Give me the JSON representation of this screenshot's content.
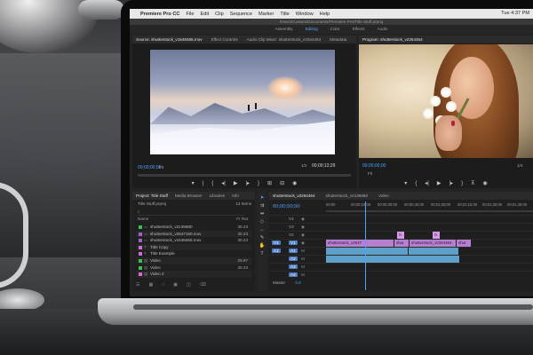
{
  "menubar": {
    "app": "Premiere Pro CC",
    "items": [
      "File",
      "Edit",
      "Clip",
      "Sequence",
      "Marker",
      "Title",
      "Window",
      "Help"
    ],
    "clock": "Tue 4:37 PM"
  },
  "path": "/Users/Custom/Documents/Premiere Pro/Title Stuff.prproj",
  "workspaces": [
    "Assembly",
    "Editing",
    "Color",
    "Effects",
    "Audio"
  ],
  "source": {
    "tabs": [
      "Source: shutterstock_v1548465.mov",
      "Effect Controls",
      "Audio Clip Mixer: shutterstock_v2264464",
      "Metadata"
    ],
    "timecode": "00;00;00;00",
    "fit": "Fit",
    "fraction": "1/2",
    "duration": "00;00;13;29"
  },
  "program": {
    "tab": "Program: shutterstock_v2264464",
    "timecode": "00;00;00;00",
    "fit": "Fit",
    "fraction": "1/4"
  },
  "transport_icons": [
    "mark-in",
    "mark-out",
    "go-to-in",
    "step-back",
    "play",
    "step-forward",
    "go-to-out",
    "insert",
    "overwrite",
    "export-frame"
  ],
  "project": {
    "tabs": [
      "Project: Title Stuff",
      "Media Browser",
      "Libraries",
      "Info"
    ],
    "file": "Title Stuff.prproj",
    "items_count": "13 Items",
    "col_name": "Name",
    "col_frame": "Fr Rat",
    "rows": [
      {
        "name": "shutterstock_v2136680",
        "dur": "30.23",
        "color": "#38c05a"
      },
      {
        "name": "shutterstock_v2647160.mov",
        "dur": "30.23",
        "color": "#9f64c8"
      },
      {
        "name": "shutterstock_v1548465.mov",
        "dur": "30.23",
        "color": "#9f64c8"
      },
      {
        "name": "Title Copy",
        "dur": "",
        "color": "#d56cd6"
      },
      {
        "name": "Title Example",
        "dur": "",
        "color": "#d56cd6"
      },
      {
        "name": "Video",
        "dur": "29.97",
        "color": "#38c05a"
      },
      {
        "name": "Video",
        "dur": "30.23",
        "color": "#38c05a"
      },
      {
        "name": "Video 2",
        "dur": "",
        "color": "#d56cd6"
      }
    ]
  },
  "timeline": {
    "tabs": [
      "shutterstock_v2264464",
      "shutterstock_v2136680",
      "Video"
    ],
    "timecode": "00;00;00;00",
    "ruler": [
      "00;00",
      "00;00;15;00",
      "00;00;30;00",
      "00;00;45;00",
      "00;01;00;00",
      "00;01;15;00",
      "00;01;30;00",
      "00;01;45;00"
    ],
    "tracks": [
      {
        "id": "V4",
        "clips": []
      },
      {
        "id": "V3",
        "clips": []
      },
      {
        "id": "V2",
        "clips": [
          {
            "label": "fx",
            "kind": "pink"
          },
          {
            "label": "fx",
            "kind": "pink"
          }
        ]
      },
      {
        "id": "V1",
        "clips": [
          {
            "label": "shutterstock_v2647",
            "kind": "v"
          },
          {
            "label": "shut",
            "kind": "v"
          },
          {
            "label": "shutterstock_v2264464",
            "kind": "v"
          },
          {
            "label": "shut",
            "kind": "v"
          }
        ]
      },
      {
        "id": "A1",
        "clips": [
          {
            "label": "",
            "kind": "a"
          },
          {
            "label": "",
            "kind": "a"
          }
        ]
      },
      {
        "id": "A2",
        "clips": [
          {
            "label": "",
            "kind": "a"
          }
        ]
      },
      {
        "id": "A3",
        "clips": []
      },
      {
        "id": "A4",
        "clips": []
      }
    ],
    "master_label": "Master",
    "master_value": "0.0"
  }
}
